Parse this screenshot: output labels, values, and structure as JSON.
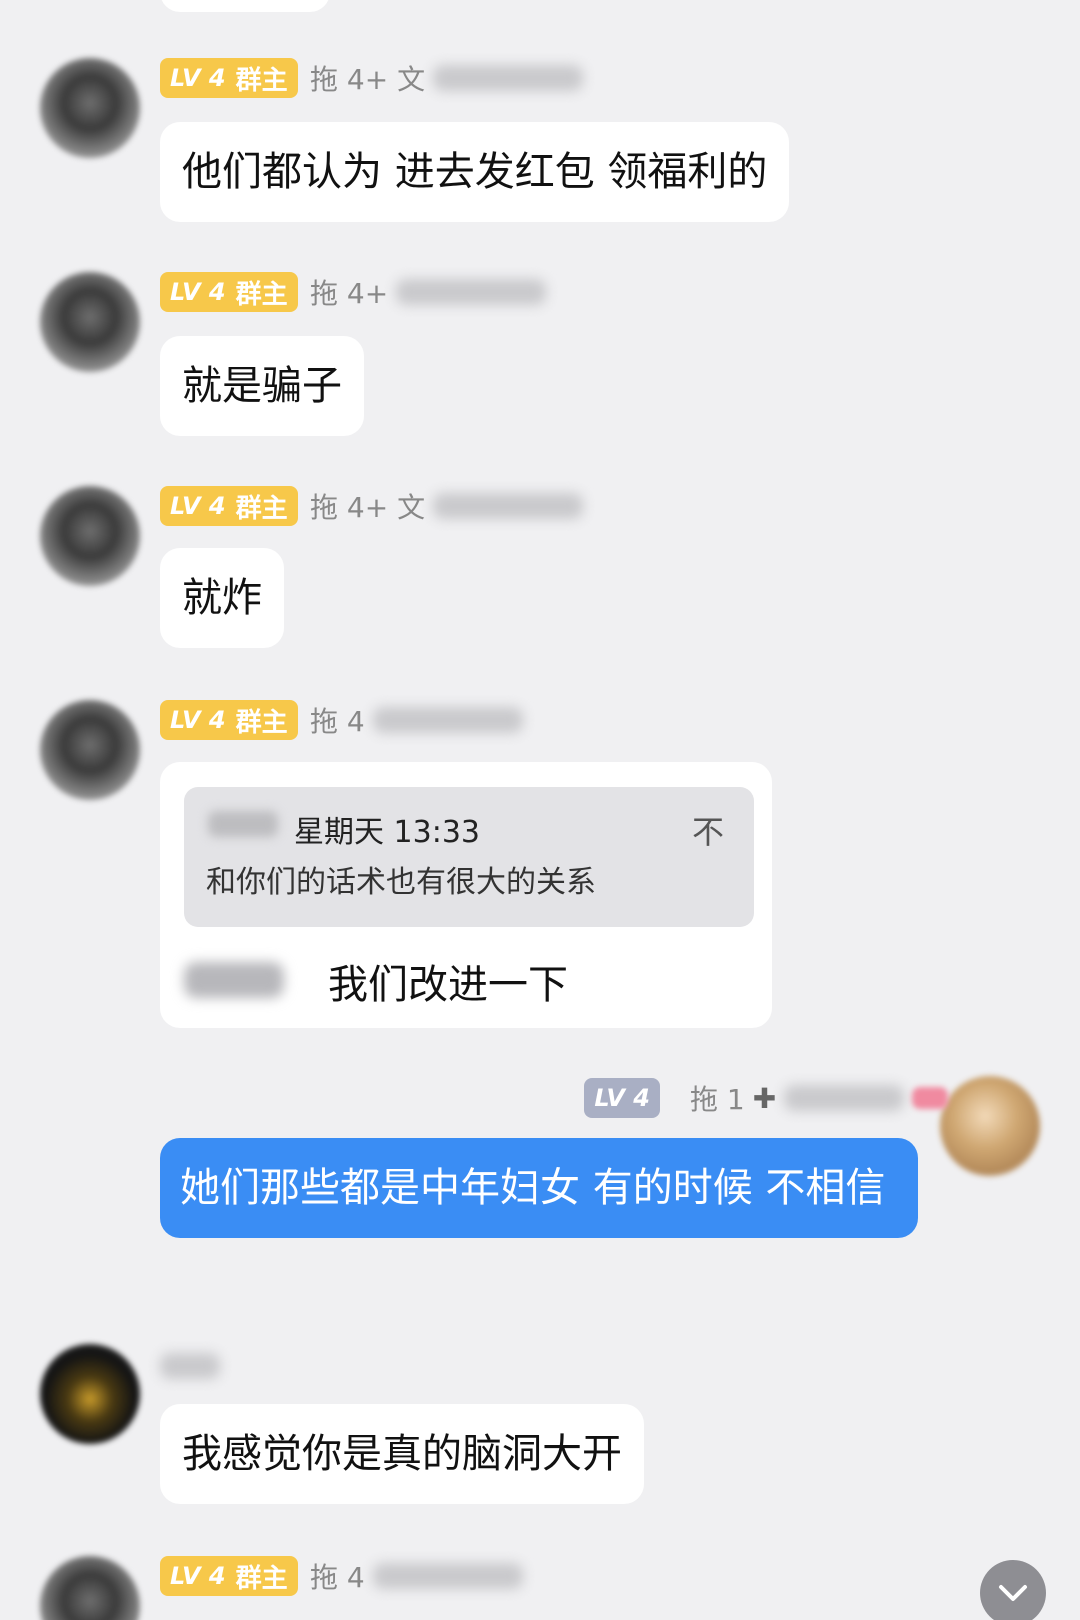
{
  "badge": {
    "level": "LV 4",
    "role": "群主"
  },
  "sender_prefix": "拖 4+",
  "sender_prefix_with_char": "拖 4+ 文",
  "sender_prefix_partial": "拖 4",
  "messages": [
    {
      "text": "他们都认为 进去发红包 领福利的"
    },
    {
      "text": "就是骗子"
    },
    {
      "text": "就炸"
    },
    {
      "quote_time": "星期天 13:33",
      "quote_text": "和你们的话术也有很大的关系",
      "quote_icon": "不",
      "reply_text": "我们改进一下"
    },
    {
      "text": "她们那些都是中年妇女 有的时候 不相信"
    },
    {
      "text": "我感觉你是真的脑洞大开"
    }
  ],
  "self_badge": {
    "level": "LV 4",
    "prefix": "拖 1"
  },
  "icons": {
    "scroll_down": "chevron-down-icon"
  },
  "colors": {
    "accent_blue": "#3a8df4",
    "badge_gold": "#f7c84a",
    "badge_grey": "#a9afc4"
  }
}
